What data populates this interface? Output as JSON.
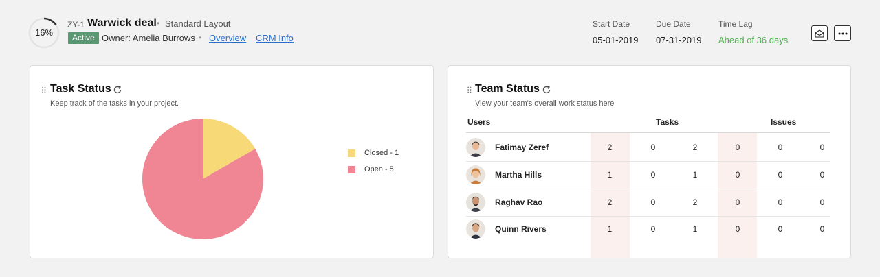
{
  "header": {
    "progress": "16%",
    "progress_value": 0.16,
    "project_id": "ZY-1",
    "project_name": "Warwick deal",
    "layout": "Standard Layout",
    "status": "Active",
    "owner": "Owner: Amelia Burrows",
    "links": [
      "Overview",
      "CRM Info"
    ],
    "start_date_label": "Start Date",
    "start_date": "05-01-2019",
    "due_date_label": "Due Date",
    "due_date": "07-31-2019",
    "time_lag_label": "Time Lag",
    "time_lag": "Ahead of 36 days",
    "accent_green": "#4fae4f",
    "badge_color": "#5a9874",
    "link_color": "#2a6fc9"
  },
  "task_status": {
    "title": "Task Status",
    "subtitle": "Keep track of the tasks in your project.",
    "legend": [
      "Closed - 1",
      "Open - 5"
    ],
    "colors": [
      "#f8d978",
      "#f08694"
    ]
  },
  "team_status": {
    "title": "Team Status",
    "subtitle": "View your team's overall work status here",
    "headers": {
      "users": "Users",
      "tasks": "Tasks",
      "issues": "Issues"
    },
    "rows": [
      {
        "name": "Fatimay Zeref",
        "values": [
          "2",
          "0",
          "2",
          "0",
          "0",
          "0"
        ]
      },
      {
        "name": "Martha Hills",
        "values": [
          "1",
          "0",
          "1",
          "0",
          "0",
          "0"
        ]
      },
      {
        "name": "Raghav Rao",
        "values": [
          "2",
          "0",
          "2",
          "0",
          "0",
          "0"
        ]
      },
      {
        "name": "Quinn Rivers",
        "values": [
          "1",
          "0",
          "1",
          "0",
          "0",
          "0"
        ]
      }
    ]
  },
  "chart_data": {
    "type": "pie",
    "categories": [
      "Closed",
      "Open"
    ],
    "values": [
      1,
      5
    ],
    "legend": [
      "Closed - 1",
      "Open - 5"
    ],
    "legend_placement": "right"
  }
}
